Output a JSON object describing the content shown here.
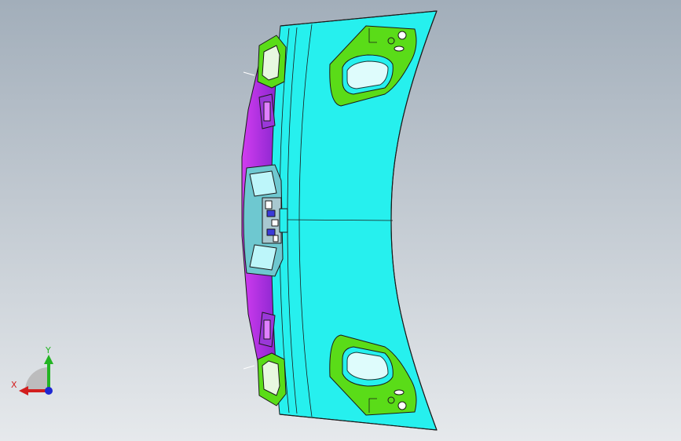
{
  "viewport": {
    "background_top": "#a2aeba",
    "background_bottom": "#e6e9ec"
  },
  "model": {
    "part_colors": {
      "panel": "#26f0ee",
      "bracket": "#5adc18",
      "inner_flange": "#a22cee",
      "clip": "#9a38d8",
      "latch": "#6ec8d0",
      "edge": "#1a1a1a"
    }
  },
  "triad": {
    "x_label": "X",
    "y_label": "Y",
    "x_color": "#d21e1e",
    "y_color": "#22b422",
    "z_color": "#1e28d2"
  }
}
